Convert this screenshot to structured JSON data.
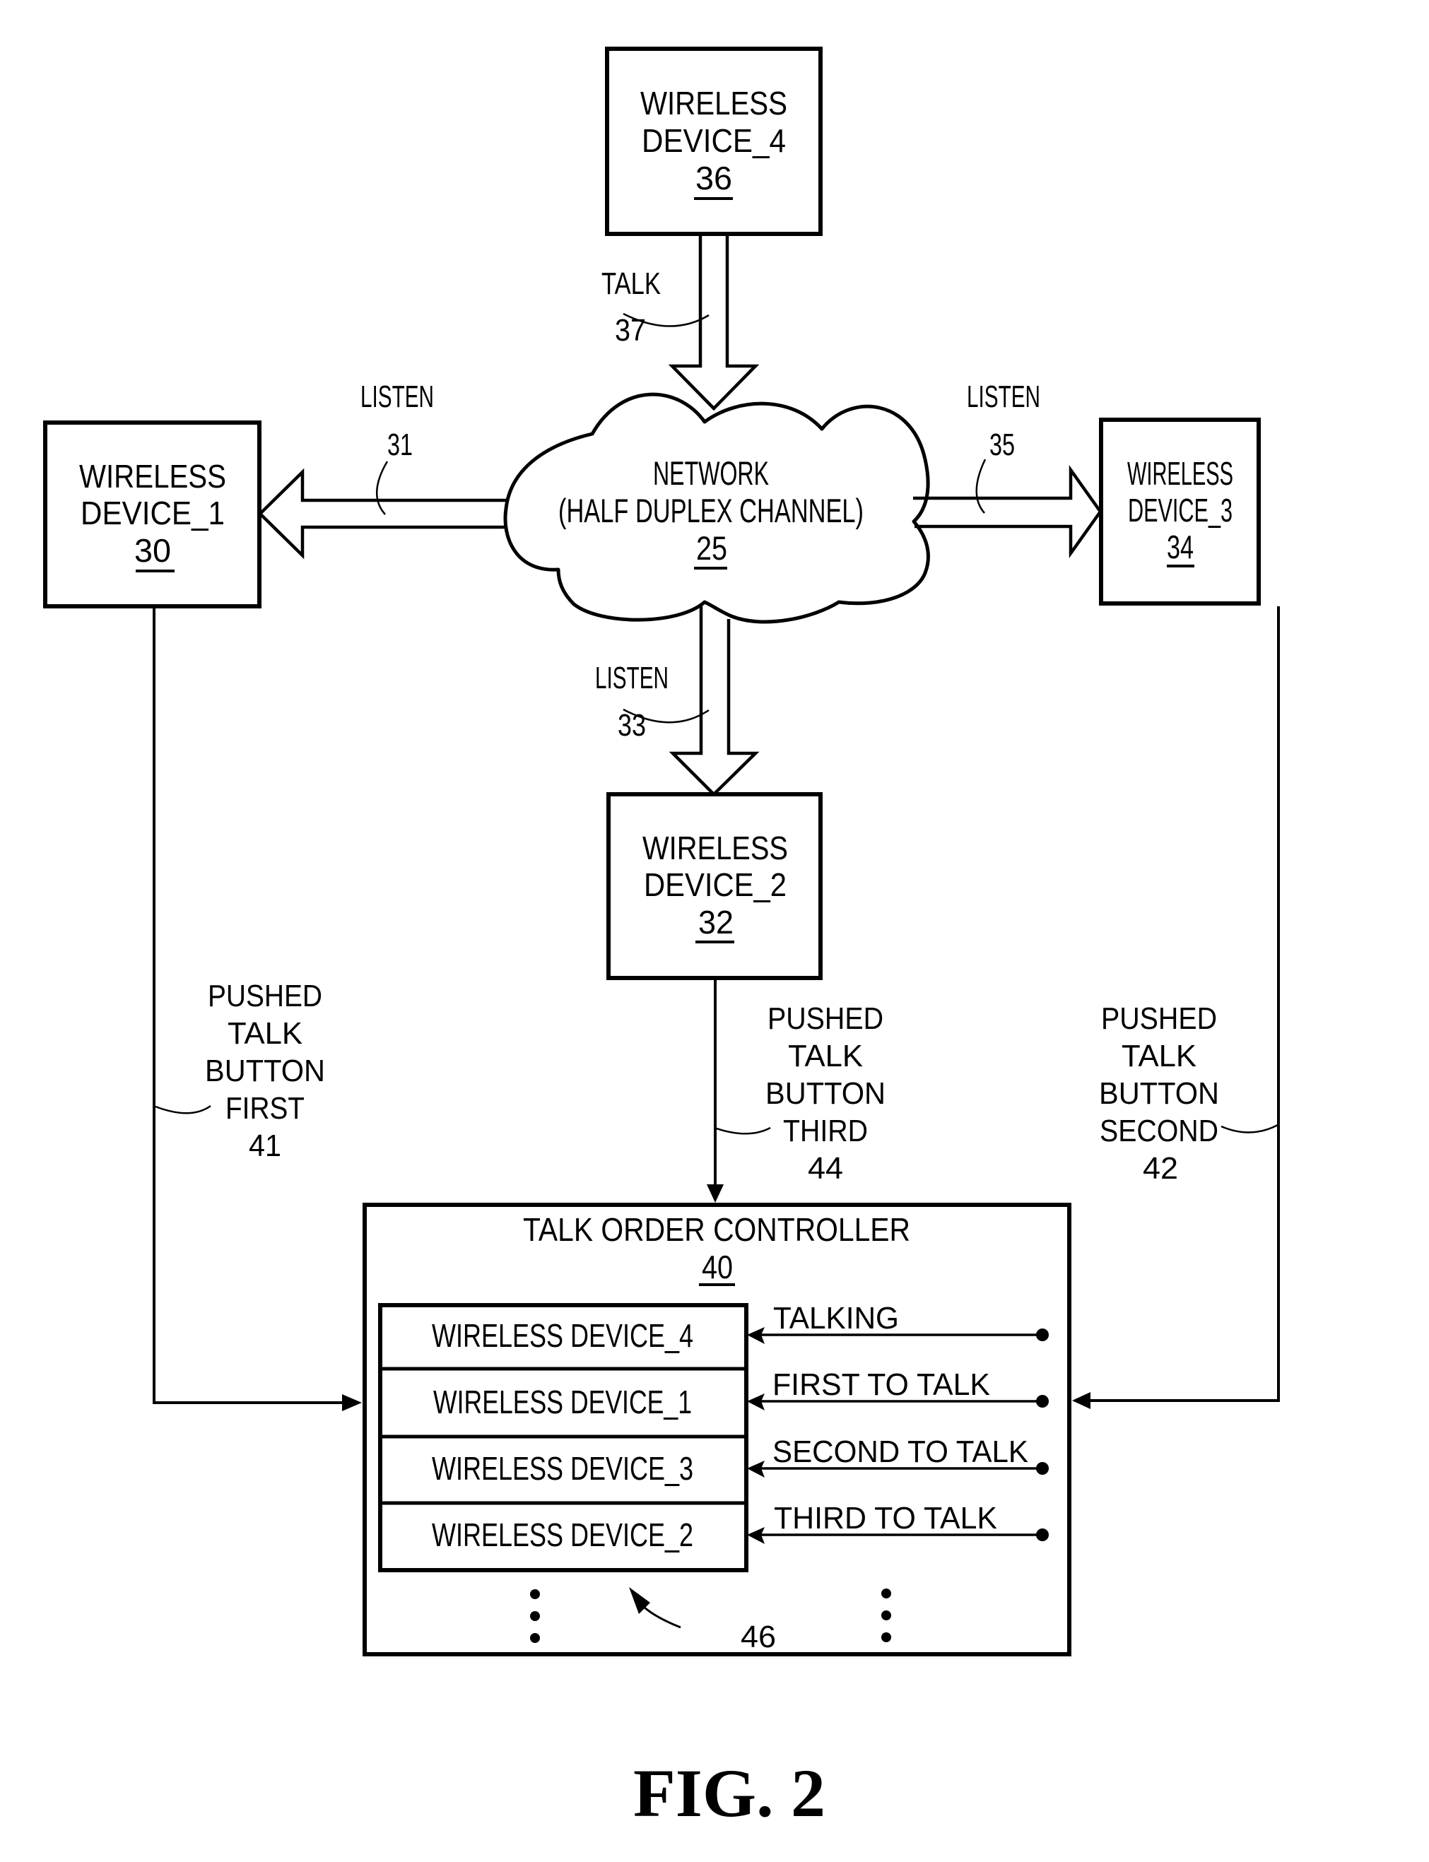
{
  "figure": {
    "caption": "FIG. 2"
  },
  "colors": {
    "ink": "#000000",
    "paper": "#ffffff"
  },
  "devices": {
    "device_4": {
      "line1": "WIRELESS",
      "line2": "DEVICE_4",
      "ref": "36"
    },
    "device_1": {
      "line1": "WIRELESS",
      "line2": "DEVICE_1",
      "ref": "30"
    },
    "device_3": {
      "line1": "WIRELESS",
      "line2": "DEVICE_3",
      "ref": "34"
    },
    "device_2": {
      "line1": "WIRELESS",
      "line2": "DEVICE_2",
      "ref": "32"
    }
  },
  "network": {
    "line1": "NETWORK",
    "line2": "(HALF DUPLEX CHANNEL)",
    "ref": "25"
  },
  "links": {
    "talk": {
      "label": "TALK",
      "ref": "37"
    },
    "listen_1": {
      "label": "LISTEN",
      "ref": "31"
    },
    "listen_3": {
      "label": "LISTEN",
      "ref": "35"
    },
    "listen_2": {
      "label": "LISTEN",
      "ref": "33"
    }
  },
  "push_signals": {
    "first": {
      "lines": [
        "PUSHED",
        "TALK",
        "BUTTON",
        "FIRST"
      ],
      "ref": "41"
    },
    "third": {
      "lines": [
        "PUSHED",
        "TALK",
        "BUTTON",
        "THIRD"
      ],
      "ref": "44"
    },
    "second": {
      "lines": [
        "PUSHED",
        "TALK",
        "BUTTON",
        "SECOND"
      ],
      "ref": "42"
    }
  },
  "controller": {
    "title": "TALK ORDER CONTROLLER",
    "ref": "40",
    "queue_ref": "46",
    "queue": [
      {
        "device": "WIRELESS DEVICE_4",
        "status": "TALKING"
      },
      {
        "device": "WIRELESS DEVICE_1",
        "status": "FIRST TO TALK"
      },
      {
        "device": "WIRELESS DEVICE_3",
        "status": "SECOND TO TALK"
      },
      {
        "device": "WIRELESS DEVICE_2",
        "status": "THIRD TO TALK"
      }
    ]
  }
}
